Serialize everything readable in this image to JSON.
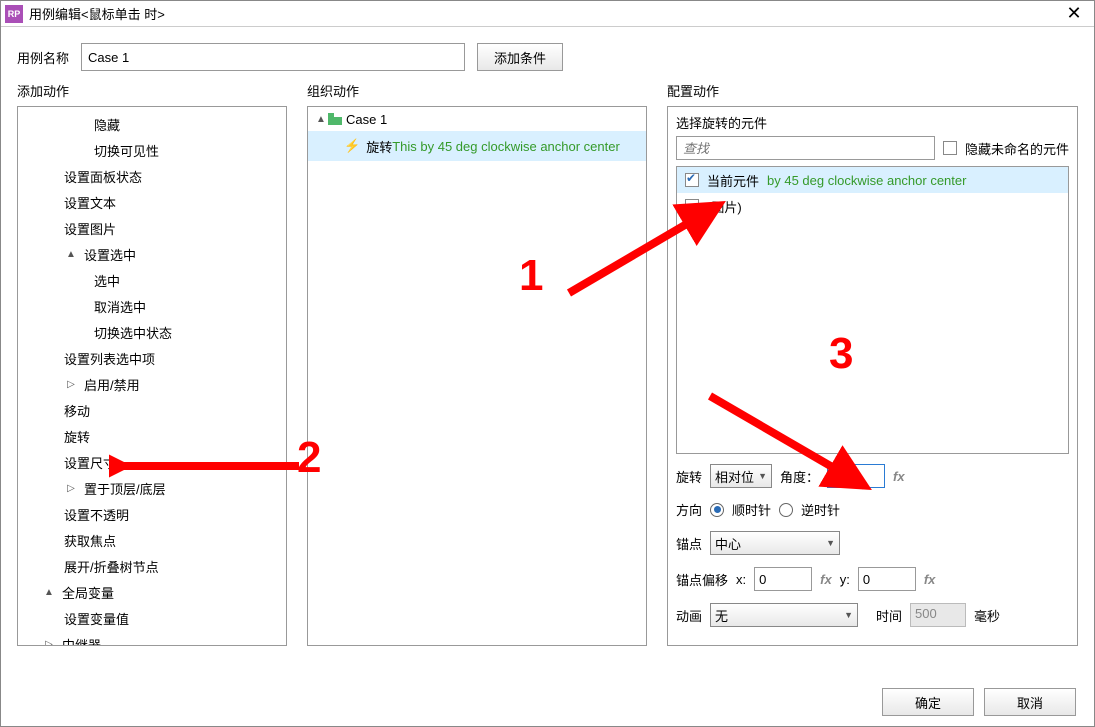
{
  "title": "用例编辑<鼠标单击 时>",
  "nameLabel": "用例名称",
  "caseName": "Case 1",
  "addCondition": "添加条件",
  "colHeads": {
    "c1": "添加动作",
    "c2": "组织动作",
    "c3": "配置动作"
  },
  "tree": {
    "hidden": "隐藏",
    "toggleVis": "切换可见性",
    "panelState": "设置面板状态",
    "setText": "设置文本",
    "setImage": "设置图片",
    "setSelGroup": "设置选中",
    "select": "选中",
    "unselect": "取消选中",
    "toggleSel": "切换选中状态",
    "setListSel": "设置列表选中项",
    "enableGroup": "启用/禁用",
    "move": "移动",
    "rotate": "旋转",
    "setSize": "设置尺寸",
    "bringFront": "置于顶层/底层",
    "opacity": "设置不透明",
    "focus": "获取焦点",
    "expandTree": "展开/折叠树节点",
    "globalVar": "全局变量",
    "setVar": "设置变量值",
    "repeater": "中继器"
  },
  "organize": {
    "caseLabel": "Case 1",
    "actionVerb": "旋转",
    "actionDesc": "This by 45 deg clockwise anchor center"
  },
  "config": {
    "head": "选择旋转的元件",
    "searchPlaceholder": "查找",
    "hideUnnamed": "隐藏未命名的元件",
    "currentWidget": "当前元件",
    "currentDesc": "by 45 deg clockwise anchor center",
    "imageWidget": "(图片)",
    "rotateLabel": "旋转",
    "relative": "相对位",
    "angleLabel": "角度：",
    "angleVal": "45",
    "dirLabel": "方向",
    "cw": "顺时针",
    "ccw": "逆时针",
    "anchorLabel": "锚点",
    "anchorVal": "中心",
    "offsetLabel": "锚点偏移",
    "x": "x:",
    "y": "y:",
    "zero": "0",
    "animLabel": "动画",
    "animVal": "无",
    "timeLabel": "时间",
    "timeVal": "500",
    "ms": "毫秒"
  },
  "footer": {
    "ok": "确定",
    "cancel": "取消"
  },
  "anno": {
    "n1": "1",
    "n2": "2",
    "n3": "3"
  }
}
